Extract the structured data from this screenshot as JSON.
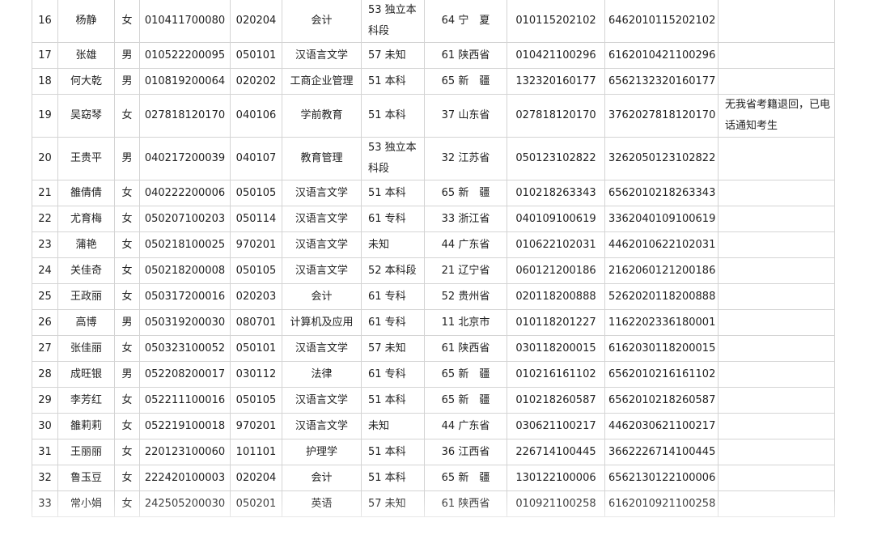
{
  "table": {
    "rows": [
      {
        "no": "16",
        "name": "杨静",
        "gender": "女",
        "exam_id": "010411700080",
        "major_code": "020204",
        "major": "会计",
        "level": "53 独立本科段",
        "province": "64 宁　夏",
        "archive_no": "010115202102",
        "student_no": "6462010115202102",
        "note": ""
      },
      {
        "no": "17",
        "name": "张雄",
        "gender": "男",
        "exam_id": "010522200095",
        "major_code": "050101",
        "major": "汉语言文学",
        "level": "57 未知",
        "province": "61 陕西省",
        "archive_no": "010421100296",
        "student_no": "6162010421100296",
        "note": ""
      },
      {
        "no": "18",
        "name": "何大乾",
        "gender": "男",
        "exam_id": "010819200064",
        "major_code": "020202",
        "major": "工商企业管理",
        "level": "51 本科",
        "province": "65 新　疆",
        "archive_no": "132320160177",
        "student_no": "6562132320160177",
        "note": ""
      },
      {
        "no": "19",
        "name": "吴窈琴",
        "gender": "女",
        "exam_id": "027818120170",
        "major_code": "040106",
        "major": "学前教育",
        "level": "51 本科",
        "province": "37 山东省",
        "archive_no": "027818120170",
        "student_no": "3762027818120170",
        "note": "无我省考籍退回，已电话通知考生"
      },
      {
        "no": "20",
        "name": "王贵平",
        "gender": "男",
        "exam_id": "040217200039",
        "major_code": "040107",
        "major": "教育管理",
        "level": "53 独立本科段",
        "province": "32 江苏省",
        "archive_no": "050123102822",
        "student_no": "3262050123102822",
        "note": ""
      },
      {
        "no": "21",
        "name": "雒倩倩",
        "gender": "女",
        "exam_id": "040222200006",
        "major_code": "050105",
        "major": "汉语言文学",
        "level": "51 本科",
        "province": "65 新　疆",
        "archive_no": "010218263343",
        "student_no": "6562010218263343",
        "note": ""
      },
      {
        "no": "22",
        "name": "尤育梅",
        "gender": "女",
        "exam_id": "050207100203",
        "major_code": "050114",
        "major": "汉语言文学",
        "level": "61 专科",
        "province": "33 浙江省",
        "archive_no": "040109100619",
        "student_no": "3362040109100619",
        "note": ""
      },
      {
        "no": "23",
        "name": "蒲艳",
        "gender": "女",
        "exam_id": "050218100025",
        "major_code": "970201",
        "major": "汉语言文学",
        "level": "未知",
        "province": "44 广东省",
        "archive_no": "010622102031",
        "student_no": "4462010622102031",
        "note": ""
      },
      {
        "no": "24",
        "name": "关佳奇",
        "gender": "女",
        "exam_id": "050218200008",
        "major_code": "050105",
        "major": "汉语言文学",
        "level": "52 本科段",
        "province": "21 辽宁省",
        "archive_no": "060121200186",
        "student_no": "2162060121200186",
        "note": ""
      },
      {
        "no": "25",
        "name": "王政丽",
        "gender": "女",
        "exam_id": "050317200016",
        "major_code": "020203",
        "major": "会计",
        "level": "61 专科",
        "province": "52 贵州省",
        "archive_no": "020118200888",
        "student_no": "5262020118200888",
        "note": ""
      },
      {
        "no": "26",
        "name": "高博",
        "gender": "男",
        "exam_id": "050319200030",
        "major_code": "080701",
        "major": "计算机及应用",
        "level": "61 专科",
        "province": "11 北京市",
        "archive_no": "010118201227",
        "student_no": "1162202336180001",
        "note": ""
      },
      {
        "no": "27",
        "name": "张佳丽",
        "gender": "女",
        "exam_id": "050323100052",
        "major_code": "050101",
        "major": "汉语言文学",
        "level": "57 未知",
        "province": "61 陕西省",
        "archive_no": "030118200015",
        "student_no": "6162030118200015",
        "note": ""
      },
      {
        "no": "28",
        "name": "成旺银",
        "gender": "男",
        "exam_id": "052208200017",
        "major_code": "030112",
        "major": "法律",
        "level": "61 专科",
        "province": "65 新　疆",
        "archive_no": "010216161102",
        "student_no": "6562010216161102",
        "note": ""
      },
      {
        "no": "29",
        "name": "李芳红",
        "gender": "女",
        "exam_id": "052211100016",
        "major_code": "050105",
        "major": "汉语言文学",
        "level": "51 本科",
        "province": "65 新　疆",
        "archive_no": "010218260587",
        "student_no": "6562010218260587",
        "note": ""
      },
      {
        "no": "30",
        "name": "雒莉莉",
        "gender": "女",
        "exam_id": "052219100018",
        "major_code": "970201",
        "major": "汉语言文学",
        "level": "未知",
        "province": "44 广东省",
        "archive_no": "030621100217",
        "student_no": "4462030621100217",
        "note": ""
      },
      {
        "no": "31",
        "name": "王丽丽",
        "gender": "女",
        "exam_id": "220123100060",
        "major_code": "101101",
        "major": "护理学",
        "level": "51 本科",
        "province": "36 江西省",
        "archive_no": "226714100445",
        "student_no": "3662226714100445",
        "note": ""
      },
      {
        "no": "32",
        "name": "鲁玉豆",
        "gender": "女",
        "exam_id": "222420100003",
        "major_code": "020204",
        "major": "会计",
        "level": "51 本科",
        "province": "65 新　疆",
        "archive_no": "130122100006",
        "student_no": "6562130122100006",
        "note": ""
      },
      {
        "no": "33",
        "name": "常小娟",
        "gender": "女",
        "exam_id": "242505200030",
        "major_code": "050201",
        "major": "英语",
        "level": "57 未知",
        "province": "61 陕西省",
        "archive_no": "010921100258",
        "student_no": "6162010921100258",
        "note": ""
      }
    ]
  }
}
